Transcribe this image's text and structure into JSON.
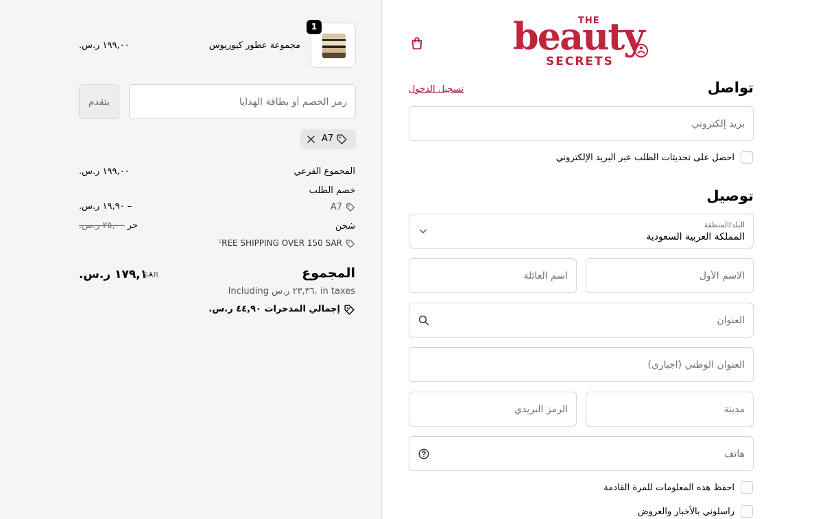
{
  "brand": {
    "logo_the": "THE",
    "logo_main": "beauty",
    "logo_sub": "SECRETS",
    "accent": "#c1243d",
    "link_color": "#b2163f"
  },
  "cart": {
    "quantity": "1",
    "product_name": "مجموعة عطور كيوريوس",
    "product_price": "١٩٩,٠٠ ر.س."
  },
  "discount": {
    "placeholder": "رمز الخصم أو بطاقة الهدايا",
    "apply_label": "يتقدم",
    "applied_code": "A7"
  },
  "totals": {
    "subtotal_label": "المجموع الفرعي",
    "subtotal_value": "١٩٩,٠٠ ر.س.",
    "order_discount_label": "خصم الطلب",
    "order_discount_code": "A7",
    "order_discount_value": "– ١٩,٩٠ ر.س.",
    "shipping_label": "شحن",
    "shipping_old": "٢٥,٠٠ ر.س.",
    "shipping_value": "حر",
    "shipping_code": "FREE SHIPPING OVER 150 SAR...",
    "total_label": "المجموع",
    "currency": "SAR",
    "total_value": "١٧٩,١٠ ر.س.",
    "taxes_note": "Including ٢٣,٣٦ ر.س. in taxes",
    "savings_label": "إجمالي المدخرات",
    "savings_value": "٤٤,٩٠ ر.س."
  },
  "contact": {
    "heading": "تواصل",
    "login_link": "تسجيل الدخول",
    "email_placeholder": "بريد إلكتروني",
    "email_updates_label": "احصل على تحديثات الطلب عبر البريد الإلكتروني"
  },
  "delivery": {
    "heading": "توصيل",
    "country_label": "البلد/المنطقة",
    "country_value": "المملكة العربية السعودية",
    "first_name_placeholder": "الاسم الأول",
    "last_name_placeholder": "اسم العائلة",
    "address_placeholder": "العنوان",
    "national_address_placeholder": "العنوان الوطني (اجباري)",
    "city_placeholder": "مدينة",
    "postal_placeholder": "الرمز البريدي",
    "phone_placeholder": "هاتف",
    "save_info_label": "احفظ هذه المعلومات للمرة القادمة",
    "newsletter_label": "راسلوني بالأخبار والعروض"
  }
}
